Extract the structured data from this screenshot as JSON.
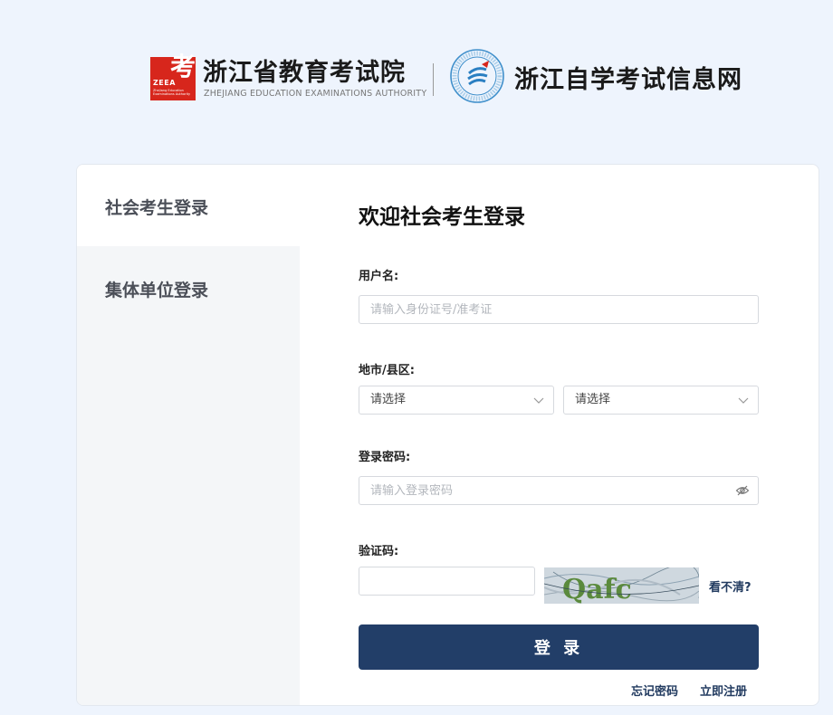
{
  "header": {
    "logo_glyph": "考",
    "logo_abbr": "ZEEA",
    "logo_small": "Zhejiang Education Examinations Authority",
    "org_name": "浙江省教育考试院",
    "org_name_en": "ZHEJIANG EDUCATION EXAMINATIONS AUTHORITY",
    "site_name": "浙江自学考试信息网"
  },
  "tabs": [
    {
      "label": "社会考生登录",
      "active": true
    },
    {
      "label": "集体单位登录",
      "active": false
    }
  ],
  "form": {
    "title": "欢迎社会考生登录",
    "username_label": "用户名:",
    "username_placeholder": "请输入身份证号/准考证",
    "region_label": "地市/县区:",
    "city_select": "请选择",
    "county_select": "请选择",
    "password_label": "登录密码:",
    "password_placeholder": "请输入登录密码",
    "captcha_label": "验证码:",
    "captcha_value": "",
    "captcha_text": "Qafc",
    "captcha_refresh": "看不清?",
    "login_button": "登 录",
    "forgot_password": "忘记密码",
    "register": "立即注册"
  },
  "colors": {
    "brand_red": "#d7261c",
    "primary_navy": "#223e68",
    "page_bg": "#eef4fd"
  }
}
